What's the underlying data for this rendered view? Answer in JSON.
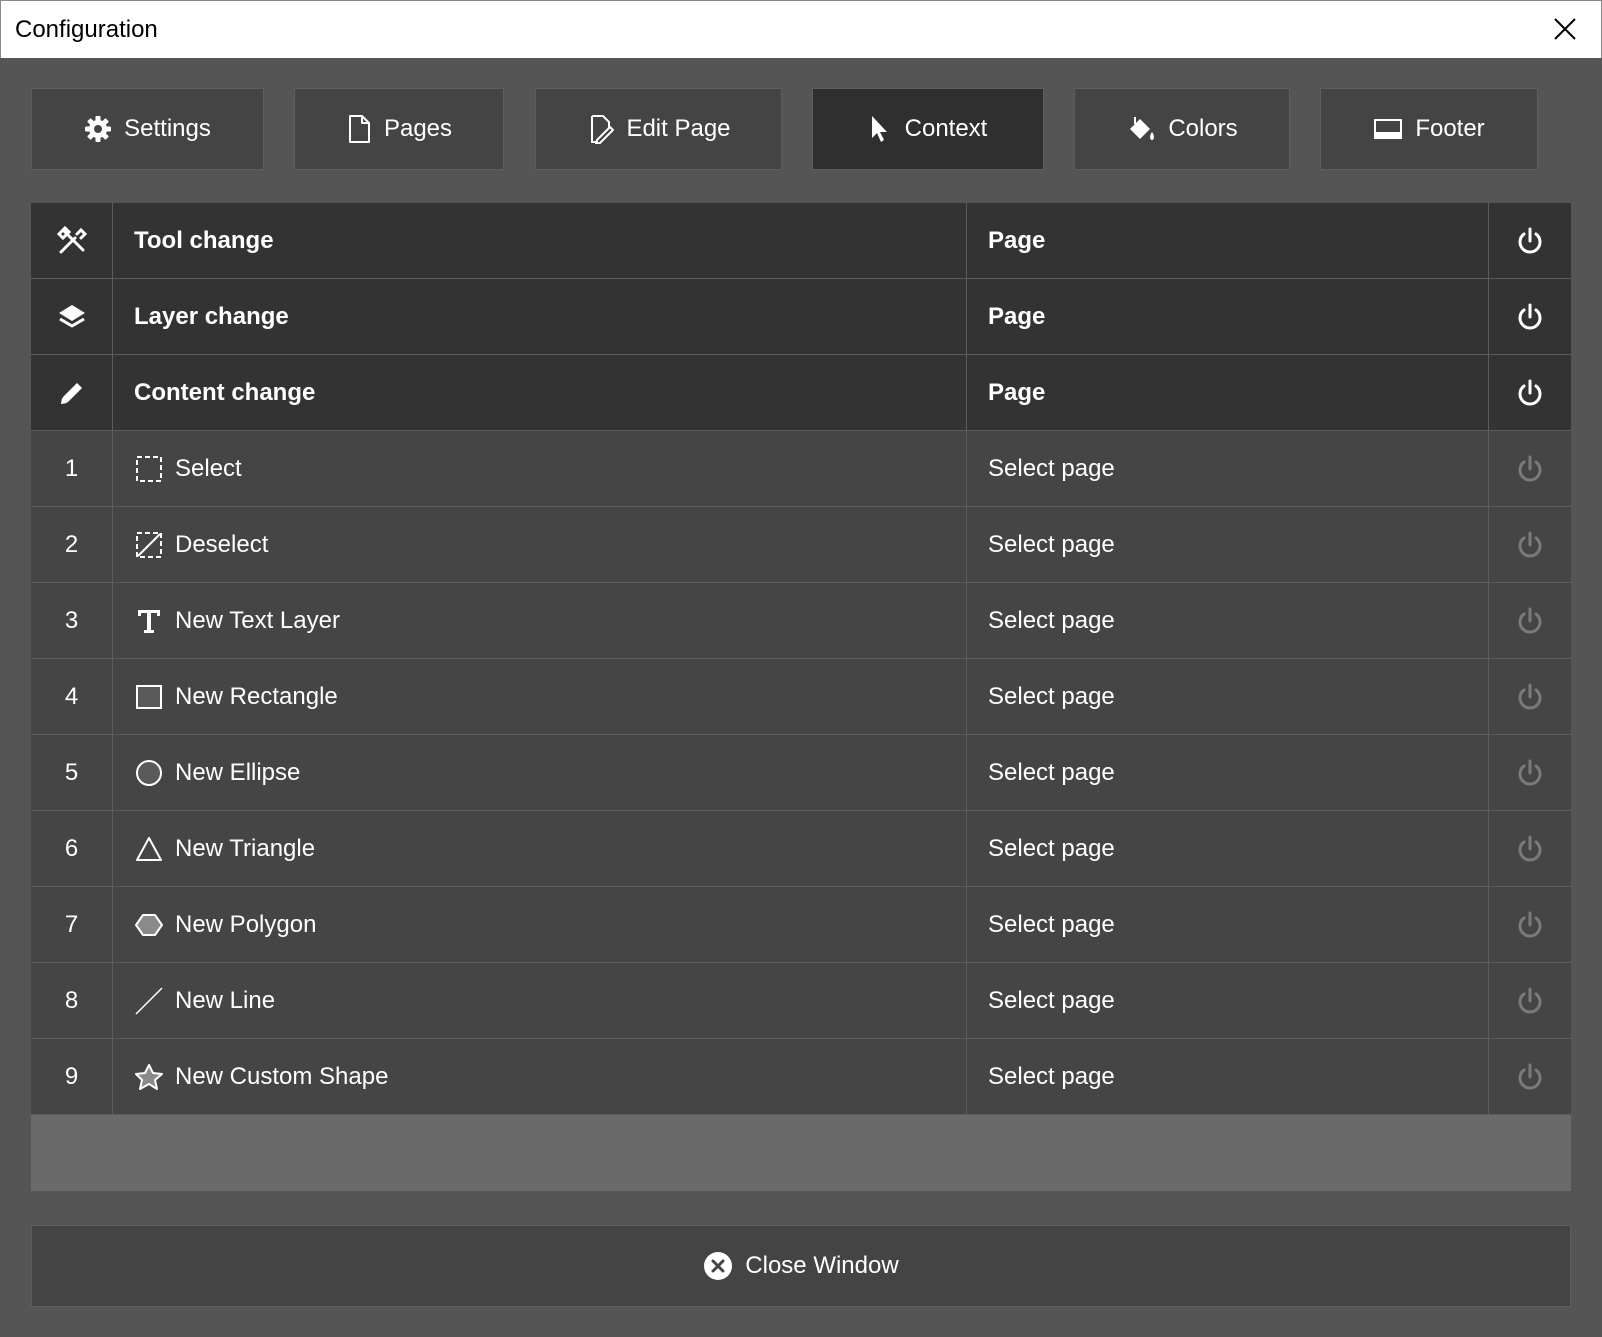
{
  "window": {
    "title": "Configuration"
  },
  "tabs": [
    {
      "label": "Settings",
      "icon": "gear-icon"
    },
    {
      "label": "Pages",
      "icon": "page-icon"
    },
    {
      "label": "Edit Page",
      "icon": "edit-page-icon"
    },
    {
      "label": "Context",
      "icon": "cursor-icon",
      "active": true
    },
    {
      "label": "Colors",
      "icon": "paint-bucket-icon"
    },
    {
      "label": "Footer",
      "icon": "footer-icon"
    }
  ],
  "header_rows": [
    {
      "name": "Tool change",
      "page": "Page",
      "icon": "tools-icon"
    },
    {
      "name": "Layer change",
      "page": "Page",
      "icon": "layers-icon"
    },
    {
      "name": "Content change",
      "page": "Page",
      "icon": "pencil-icon"
    }
  ],
  "tool_rows": [
    {
      "index": "1",
      "name": "Select",
      "page": "Select page",
      "icon": "select-icon"
    },
    {
      "index": "2",
      "name": "Deselect",
      "page": "Select page",
      "icon": "deselect-icon"
    },
    {
      "index": "3",
      "name": "New Text Layer",
      "page": "Select page",
      "icon": "text-icon"
    },
    {
      "index": "4",
      "name": "New Rectangle",
      "page": "Select page",
      "icon": "rectangle-icon"
    },
    {
      "index": "5",
      "name": "New Ellipse",
      "page": "Select page",
      "icon": "ellipse-icon"
    },
    {
      "index": "6",
      "name": "New Triangle",
      "page": "Select page",
      "icon": "triangle-icon"
    },
    {
      "index": "7",
      "name": "New Polygon",
      "page": "Select page",
      "icon": "polygon-icon"
    },
    {
      "index": "8",
      "name": "New Line",
      "page": "Select page",
      "icon": "line-icon"
    },
    {
      "index": "9",
      "name": "New Custom Shape",
      "page": "Select page",
      "icon": "custom-shape-icon"
    }
  ],
  "close_button": {
    "label": "Close Window",
    "icon": "close-circle-icon"
  },
  "colors": {
    "background": "#555555",
    "header_row": "#333333",
    "item_row": "#454545",
    "active_tab": "#2f2f2f",
    "power_on": "#ffffff",
    "power_off": "#7a7a7a"
  }
}
